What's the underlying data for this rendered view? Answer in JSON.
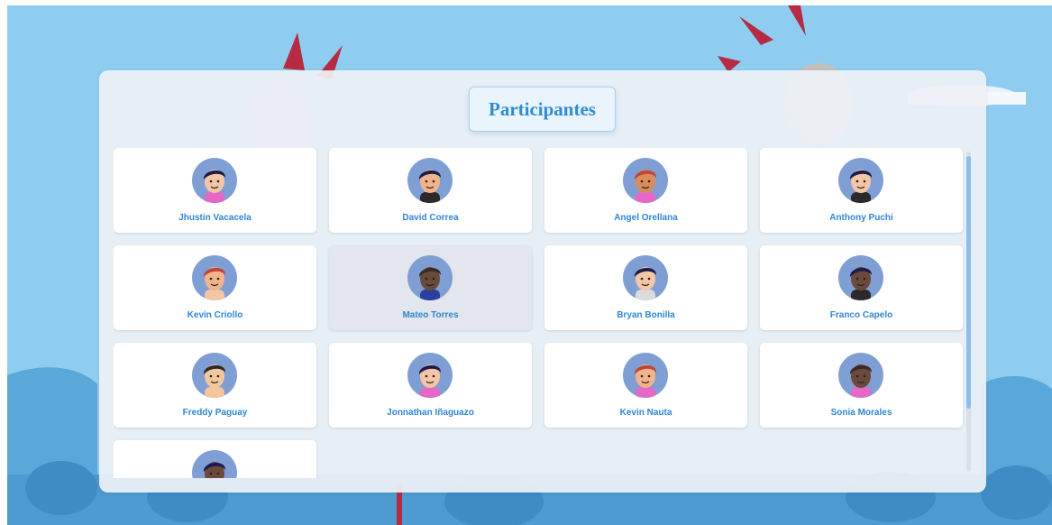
{
  "page": {
    "title": "Participantes"
  },
  "participants": [
    {
      "name": "Jhustin Vacacela",
      "skin": "#f4c6a6",
      "hair": "#1c1c4a",
      "shirt": "#e567c6"
    },
    {
      "name": "David Correa",
      "skin": "#f2b38a",
      "hair": "#1c1c4a",
      "shirt": "#2a2a2a"
    },
    {
      "name": "Angel Orellana",
      "skin": "#d98b5b",
      "hair": "#c0443a",
      "shirt": "#e567c6"
    },
    {
      "name": "Anthony Puchi",
      "skin": "#f4c6a6",
      "hair": "#1c1c4a",
      "shirt": "#2a2a2a"
    },
    {
      "name": "Kevin Criollo",
      "skin": "#f2b38a",
      "hair": "#c0443a",
      "shirt": "#f4c6a6"
    },
    {
      "name": "Mateo Torres",
      "skin": "#6a4a3a",
      "hair": "#3a2a2a",
      "shirt": "#2a3f9e"
    },
    {
      "name": "Bryan Bonilla",
      "skin": "#f4c6a6",
      "hair": "#1c1c4a",
      "shirt": "#dcdcdc"
    },
    {
      "name": "Franco Capelo",
      "skin": "#6a4a3a",
      "hair": "#1c1c4a",
      "shirt": "#2a2a2a"
    },
    {
      "name": "Freddy Paguay",
      "skin": "#f2c79e",
      "hair": "#2a2a2a",
      "shirt": "#f2c79e"
    },
    {
      "name": "Jonnathan Iñaguazo",
      "skin": "#f4c6a6",
      "hair": "#1c1c4a",
      "shirt": "#e567c6"
    },
    {
      "name": "Kevin Nauta",
      "skin": "#f2b38a",
      "hair": "#c0443a",
      "shirt": "#e567c6"
    },
    {
      "name": "Sonia Morales",
      "skin": "#6a4a3a",
      "hair": "#3a2a2a",
      "shirt": "#e567c6"
    },
    {
      "name": "",
      "skin": "#6a4a3a",
      "hair": "#1c1c4a",
      "shirt": "#2a2a2a"
    }
  ]
}
